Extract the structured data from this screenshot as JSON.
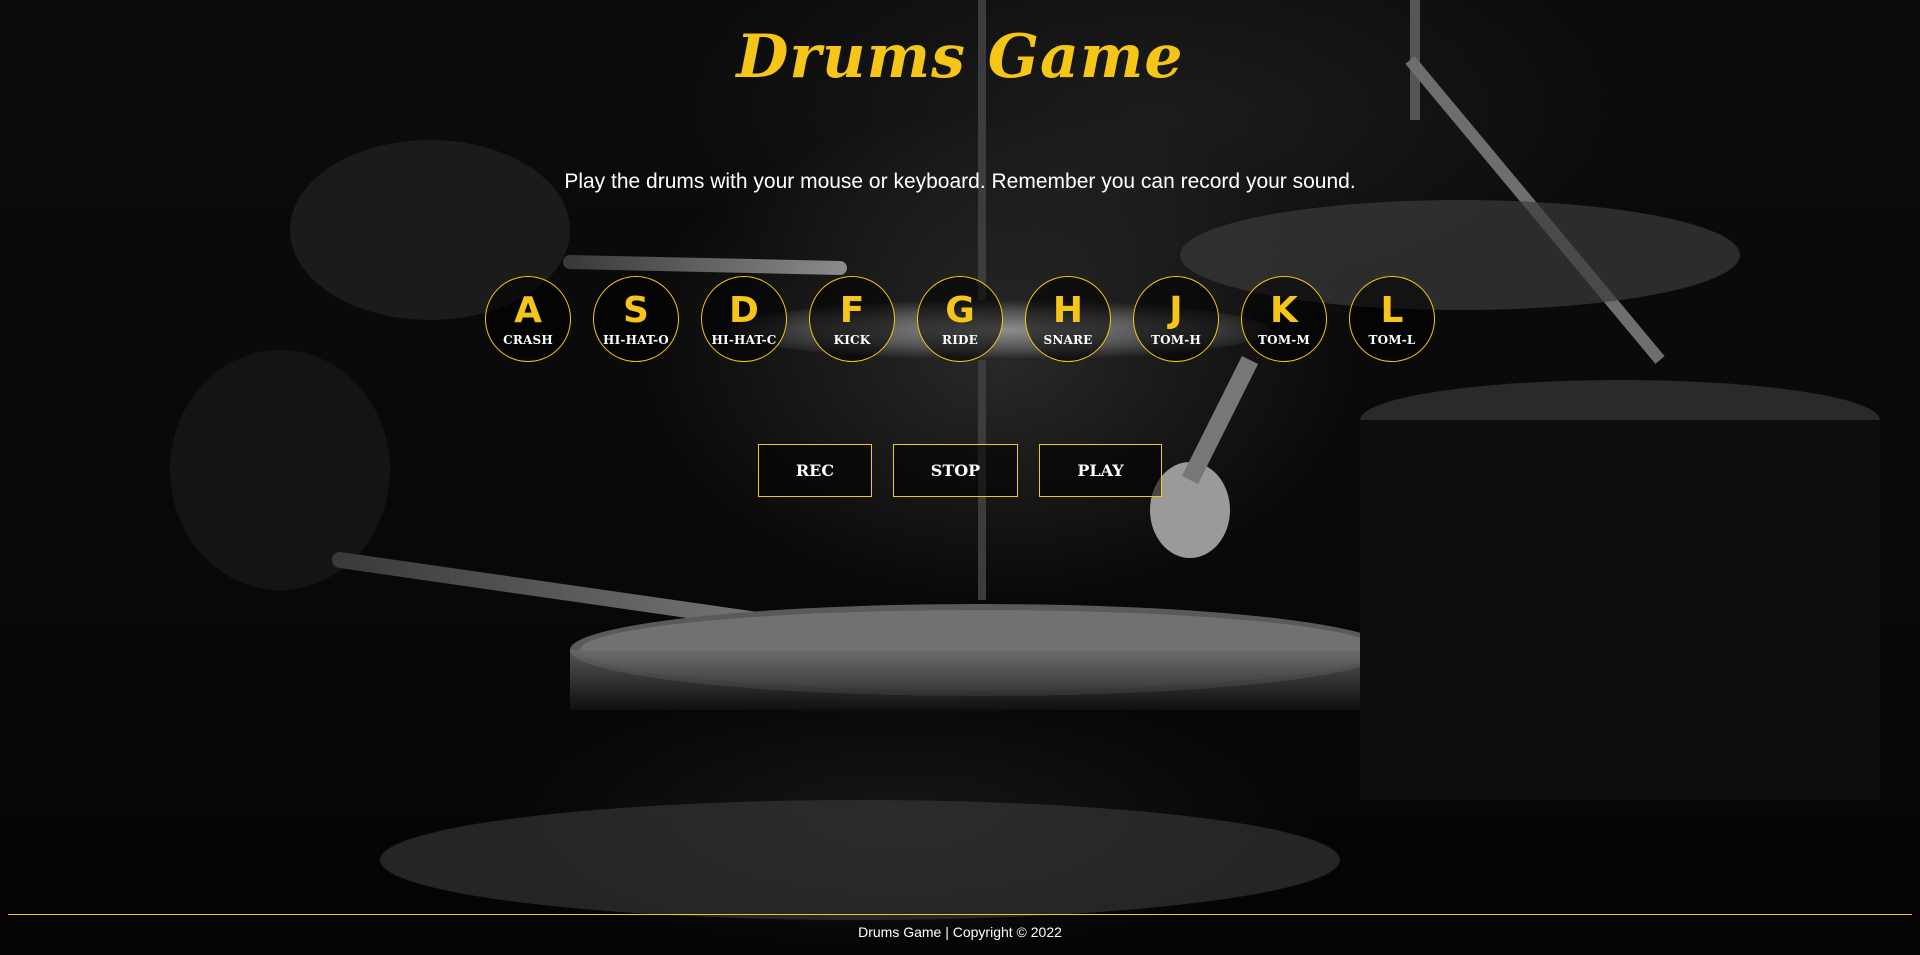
{
  "header": {
    "title": "Drums Game"
  },
  "instructions": "Play the drums with your mouse or keyboard. Remember you can record your sound.",
  "pads": [
    {
      "key": "A",
      "label": "CRASH"
    },
    {
      "key": "S",
      "label": "HI-HAT-O"
    },
    {
      "key": "D",
      "label": "HI-HAT-C"
    },
    {
      "key": "F",
      "label": "KICK"
    },
    {
      "key": "G",
      "label": "RIDE"
    },
    {
      "key": "H",
      "label": "SNARE"
    },
    {
      "key": "J",
      "label": "TOM-H"
    },
    {
      "key": "K",
      "label": "TOM-M"
    },
    {
      "key": "L",
      "label": "TOM-L"
    }
  ],
  "controls": {
    "rec_label": "REC",
    "stop_label": "STOP",
    "play_label": "PLAY"
  },
  "footer": {
    "text": "Drums Game | Copyright © 2022"
  },
  "colors": {
    "accent": "#f5c518",
    "text": "#ffffff",
    "background": "#050505"
  }
}
